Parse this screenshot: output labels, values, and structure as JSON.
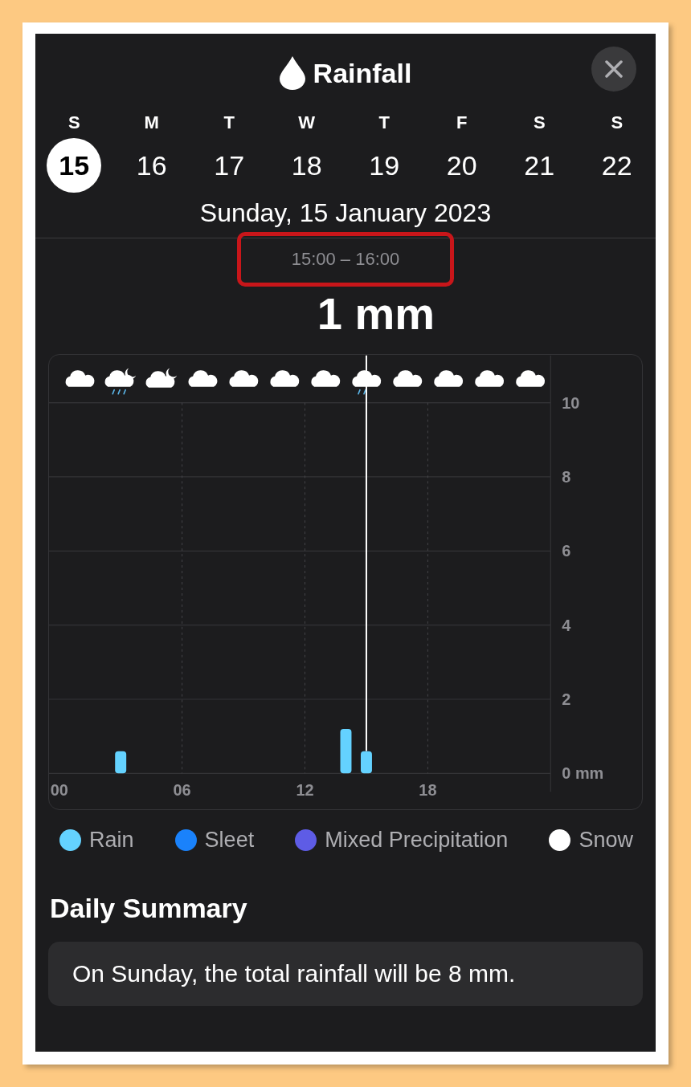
{
  "header": {
    "title": "Rainfall"
  },
  "days": [
    {
      "weekday": "S",
      "date": "15",
      "selected": true
    },
    {
      "weekday": "M",
      "date": "16",
      "selected": false
    },
    {
      "weekday": "T",
      "date": "17",
      "selected": false
    },
    {
      "weekday": "W",
      "date": "18",
      "selected": false
    },
    {
      "weekday": "T",
      "date": "19",
      "selected": false
    },
    {
      "weekday": "F",
      "date": "20",
      "selected": false
    },
    {
      "weekday": "S",
      "date": "21",
      "selected": false
    },
    {
      "weekday": "S",
      "date": "22",
      "selected": false
    }
  ],
  "full_date": "Sunday, 15 January 2023",
  "time_range": {
    "text": "15:00 – 16:00",
    "highlighted": true
  },
  "amount": "1 mm",
  "weather_icons": [
    {
      "kind": "cloud"
    },
    {
      "kind": "cloud-moon-rain"
    },
    {
      "kind": "cloud-moon"
    },
    {
      "kind": "cloud"
    },
    {
      "kind": "cloud"
    },
    {
      "kind": "cloud"
    },
    {
      "kind": "cloud"
    },
    {
      "kind": "cloud-rain"
    },
    {
      "kind": "cloud"
    },
    {
      "kind": "cloud"
    },
    {
      "kind": "cloud"
    },
    {
      "kind": "cloud"
    }
  ],
  "chart_data": {
    "type": "bar",
    "x": [
      0,
      1,
      2,
      3,
      4,
      5,
      6,
      7,
      8,
      9,
      10,
      11,
      12,
      13,
      14,
      15,
      16,
      17,
      18,
      19,
      20,
      21,
      22,
      23
    ],
    "series": [
      {
        "name": "Rain",
        "color": "#64d2ff",
        "values": [
          0,
          0,
          0,
          0.6,
          0,
          0,
          0,
          0,
          0,
          0,
          0,
          0,
          0,
          0,
          1.2,
          0.6,
          0,
          0,
          0,
          0,
          0,
          0,
          0,
          0
        ]
      },
      {
        "name": "Sleet",
        "color": "#1a82fb",
        "values": [
          null,
          null,
          null,
          null,
          null,
          null,
          null,
          null,
          null,
          null,
          null,
          null,
          null,
          null,
          null,
          null,
          null,
          null,
          null,
          null,
          null,
          null,
          null,
          null
        ]
      },
      {
        "name": "Mixed Precipitation",
        "color": "#5e5ce6",
        "values": [
          null,
          null,
          null,
          null,
          null,
          null,
          null,
          null,
          null,
          null,
          null,
          null,
          null,
          null,
          null,
          null,
          null,
          null,
          null,
          null,
          null,
          null,
          null,
          null
        ]
      },
      {
        "name": "Snow",
        "color": "#ffffff",
        "values": [
          null,
          null,
          null,
          null,
          null,
          null,
          null,
          null,
          null,
          null,
          null,
          null,
          null,
          null,
          null,
          null,
          null,
          null,
          null,
          null,
          null,
          null,
          null,
          null
        ]
      }
    ],
    "xlim": [
      -0.5,
      24
    ],
    "ylim": [
      0,
      10
    ],
    "grid": true,
    "xticks": [
      {
        "value": 0,
        "label": "00"
      },
      {
        "value": 6,
        "label": "06"
      },
      {
        "value": 12,
        "label": "12"
      },
      {
        "value": 18,
        "label": "18"
      }
    ],
    "yticks": [
      {
        "value": 0,
        "label": "0 mm"
      },
      {
        "value": 2,
        "label": "2"
      },
      {
        "value": 4,
        "label": "4"
      },
      {
        "value": 6,
        "label": "6"
      },
      {
        "value": 8,
        "label": "8"
      },
      {
        "value": 10,
        "label": "10"
      }
    ],
    "ref_lines": [
      {
        "axis": "x",
        "value": 15,
        "color": "#ffffff"
      }
    ]
  },
  "summary": {
    "title": "Daily Summary",
    "text": "On Sunday, the total rainfall will be 8 mm."
  }
}
